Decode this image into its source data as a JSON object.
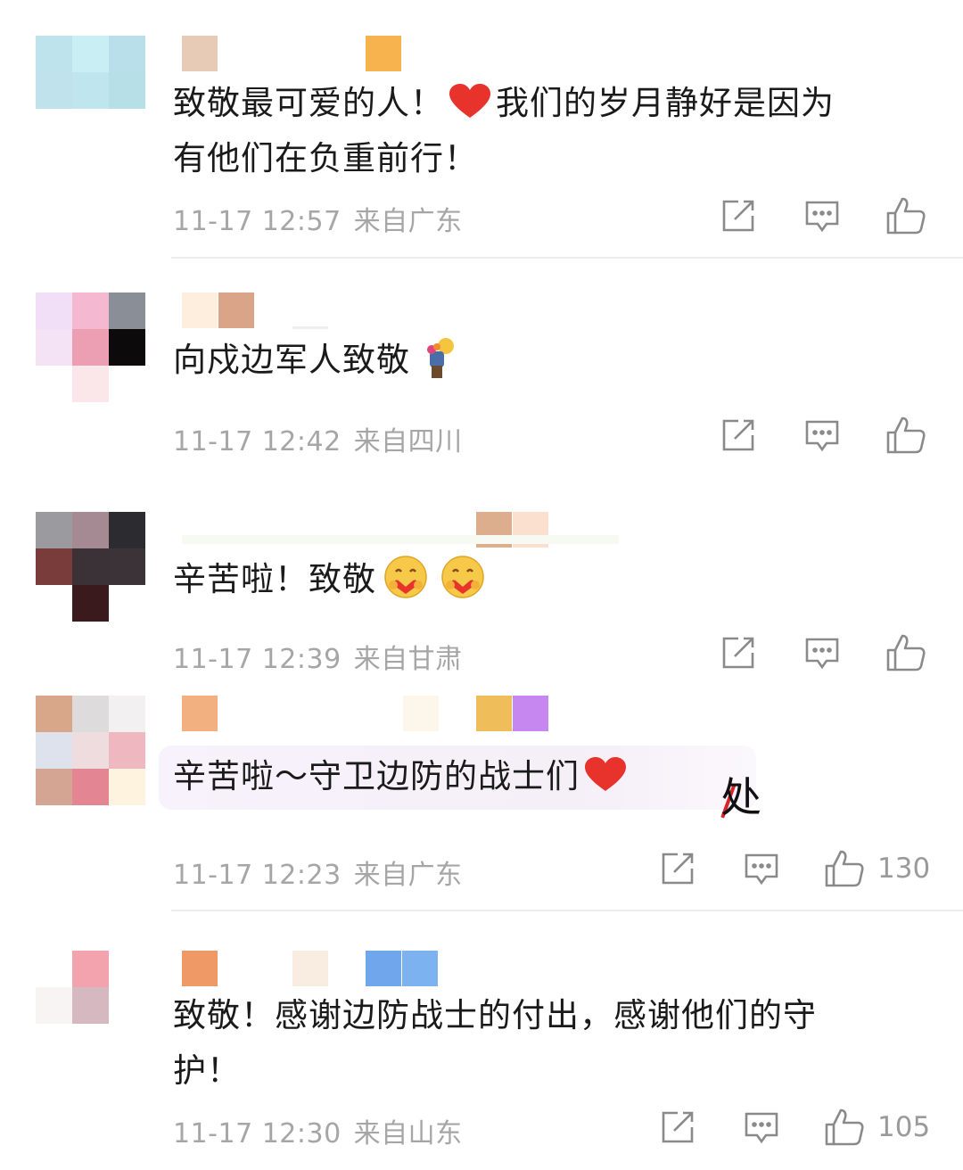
{
  "comments": [
    {
      "text_lines": [
        "致敬最可爱的人！",
        "我们的岁月静好是因为",
        "有他们在负重前行！"
      ],
      "date": "11-17 12:57",
      "location": "来自广东",
      "likes": ""
    },
    {
      "text_lines": [
        "向戍边军人致敬"
      ],
      "date": "11-17 12:42",
      "location": "来自四川",
      "likes": ""
    },
    {
      "text_lines": [
        "辛苦啦！致敬"
      ],
      "date": "11-17 12:39",
      "location": "来自甘肃",
      "likes": ""
    },
    {
      "text_lines": [
        "辛苦啦～守卫边防的战士们"
      ],
      "date": "11-17 12:23",
      "location": "来自广东",
      "likes": "130"
    },
    {
      "text_lines": [
        "致敬！感谢边防战士的付出，感谢他们的守",
        "护！"
      ],
      "date": "11-17 12:30",
      "location": "来自山东",
      "likes": "105"
    }
  ],
  "handwriting": "处",
  "icons": {
    "share": "share-icon",
    "reply": "comment-icon",
    "like": "thumbs-up-icon",
    "heart": "red-heart-emoji",
    "bouquet": "person-with-flowers-emoji",
    "hug": "hugging-face-emoji"
  },
  "colors": {
    "text": "#1a1a1a",
    "meta": "#a6a6a6",
    "icon": "#8a8a8a",
    "heart": "#e8322c",
    "divider": "#ededed"
  }
}
